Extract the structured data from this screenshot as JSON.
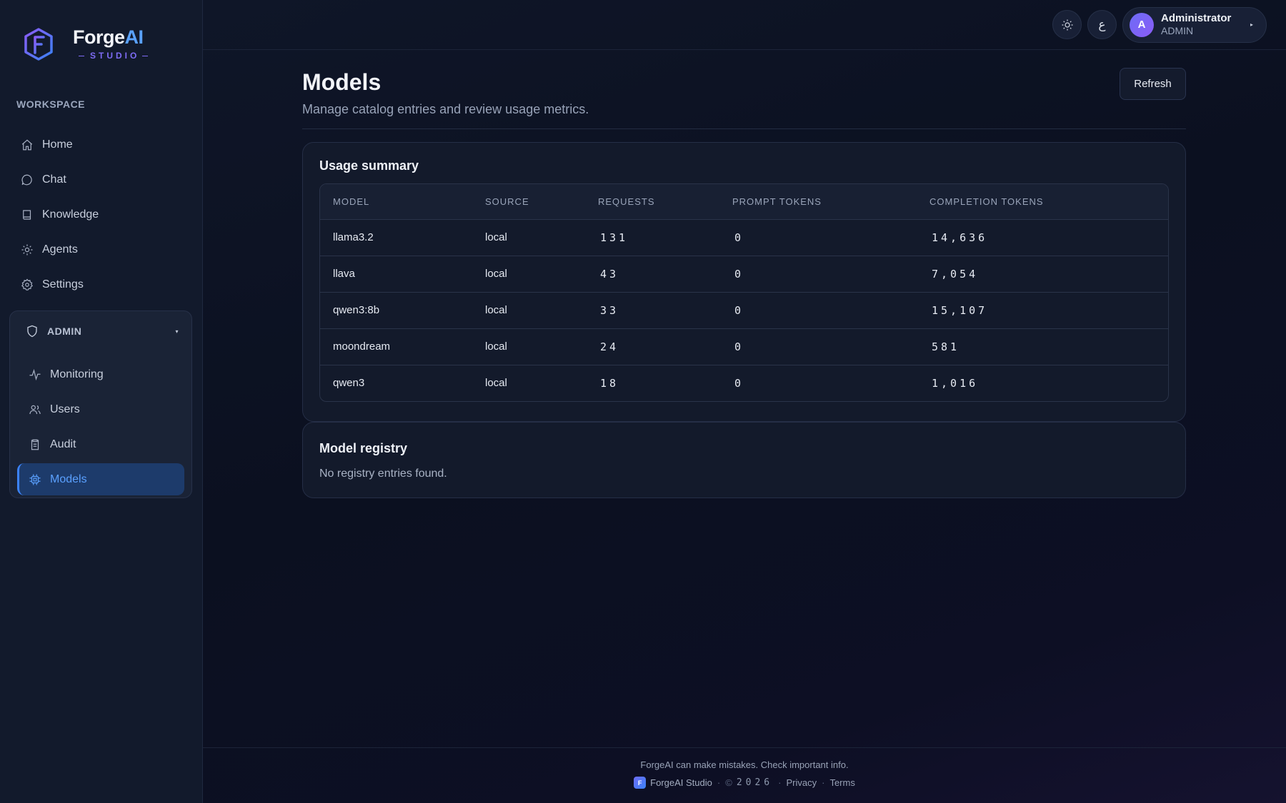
{
  "brand": {
    "name_main": "Forge",
    "name_accent": "AI",
    "subtitle": "STUDIO"
  },
  "sidebar": {
    "section_label": "WORKSPACE",
    "items": [
      {
        "label": "Home",
        "icon": "home-icon"
      },
      {
        "label": "Chat",
        "icon": "chat-icon"
      },
      {
        "label": "Knowledge",
        "icon": "book-icon"
      },
      {
        "label": "Agents",
        "icon": "sparkle-icon"
      },
      {
        "label": "Settings",
        "icon": "gear-icon"
      }
    ],
    "admin": {
      "label": "ADMIN",
      "items": [
        {
          "label": "Monitoring",
          "icon": "activity-icon"
        },
        {
          "label": "Users",
          "icon": "users-icon"
        },
        {
          "label": "Audit",
          "icon": "clipboard-icon"
        },
        {
          "label": "Models",
          "icon": "chip-icon",
          "active": true
        }
      ]
    }
  },
  "topbar": {
    "language_glyph": "ع",
    "user": {
      "initial": "A",
      "name": "Administrator",
      "role": "ADMIN"
    }
  },
  "page": {
    "title": "Models",
    "description": "Manage catalog entries and review usage metrics.",
    "refresh_label": "Refresh"
  },
  "usage": {
    "title": "Usage summary",
    "columns": [
      "MODEL",
      "SOURCE",
      "REQUESTS",
      "PROMPT TOKENS",
      "COMPLETION TOKENS"
    ],
    "rows": [
      {
        "model": "llama3.2",
        "source": "local",
        "requests": "131",
        "prompt_tokens": "0",
        "completion_tokens": "14,636"
      },
      {
        "model": "llava",
        "source": "local",
        "requests": "43",
        "prompt_tokens": "0",
        "completion_tokens": "7,054"
      },
      {
        "model": "qwen3:8b",
        "source": "local",
        "requests": "33",
        "prompt_tokens": "0",
        "completion_tokens": "15,107"
      },
      {
        "model": "moondream",
        "source": "local",
        "requests": "24",
        "prompt_tokens": "0",
        "completion_tokens": "581"
      },
      {
        "model": "qwen3",
        "source": "local",
        "requests": "18",
        "prompt_tokens": "0",
        "completion_tokens": "1,016"
      }
    ]
  },
  "registry": {
    "title": "Model registry",
    "empty_text": "No registry entries found."
  },
  "footer": {
    "note": "ForgeAI can make mistakes. Check important info.",
    "brand": "ForgeAI Studio",
    "logo_letter": "F",
    "copyright_symbol": "©",
    "year": "2026",
    "privacy": "Privacy",
    "terms": "Terms"
  },
  "colors": {
    "accent": "#3b82f6",
    "active_bg": "#1d3b6b",
    "brand_purple": "#7e6cf5"
  }
}
